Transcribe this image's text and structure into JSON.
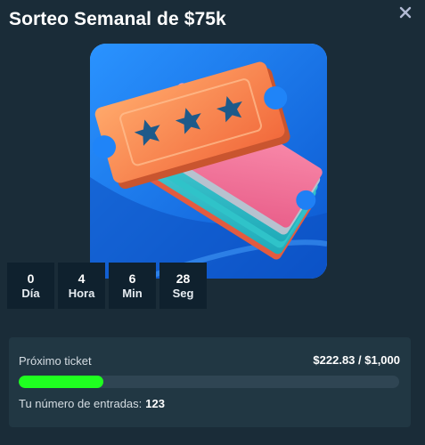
{
  "modal": {
    "title": "Sorteo Semanal de $75k",
    "close_icon": "close-icon"
  },
  "hero": {
    "icon": "raffle-tickets-illustration",
    "colors": {
      "background": "#1e87ff",
      "ticket_front": "#f5874e",
      "star": "#1e5a8a"
    }
  },
  "countdown": [
    {
      "value": "0",
      "unit": "Día"
    },
    {
      "value": "4",
      "unit": "Hora"
    },
    {
      "value": "6",
      "unit": "Min"
    },
    {
      "value": "28",
      "unit": "Seg"
    }
  ],
  "progress": {
    "label": "Próximo ticket",
    "amount": "$222.83 / $1,000",
    "fraction": 0.22283,
    "entries_label": "Tu número de entradas:",
    "entries_value": "123",
    "bar_color": "#1fff20"
  }
}
